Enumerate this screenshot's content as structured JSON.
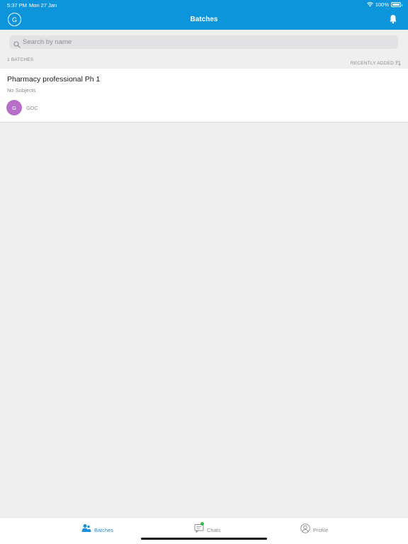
{
  "status_bar": {
    "time": "5:37 PM",
    "date": "Mon 27 Jan",
    "battery": "100%"
  },
  "header": {
    "avatar_initial": "G",
    "title": "Batches",
    "notification_icon": "bell-icon"
  },
  "search": {
    "placeholder": "Search by name",
    "value": ""
  },
  "list_header": {
    "count": "1 BATCHES",
    "sort_label": "RECENTLY ADDED"
  },
  "batches": [
    {
      "title": "Pharmacy professional Ph 1",
      "subtitle": "No Subjects",
      "owner_initial": "G",
      "owner_name": "GDC"
    }
  ],
  "tabs": [
    {
      "label": "Batches",
      "icon": "batches-icon",
      "active": true
    },
    {
      "label": "Chats",
      "icon": "chat-icon",
      "active": false
    },
    {
      "label": "Profile",
      "icon": "profile-icon",
      "active": false
    }
  ],
  "colors": {
    "header_bg": "#0d95dc",
    "active_tab": "#1f8fd8",
    "owner_avatar": "#b86fc8",
    "chat_badge": "#2fbf4c"
  }
}
